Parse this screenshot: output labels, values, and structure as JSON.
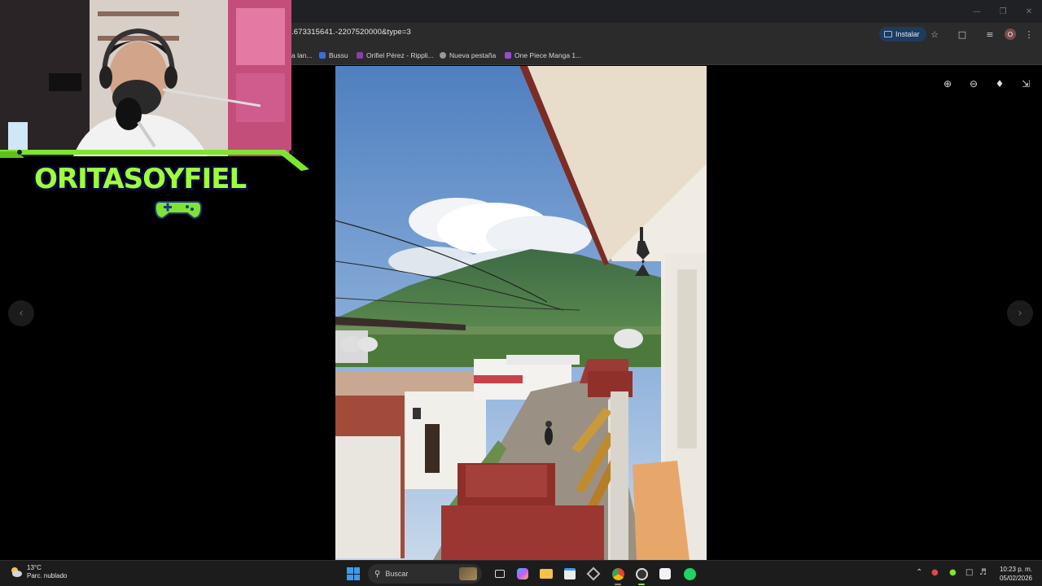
{
  "browser": {
    "url": ".673315641.-2207520000&type=3",
    "install_label": "Instalar",
    "profile_initial": "O",
    "bookmarks": [
      {
        "label": "a lan...",
        "color": "#555555"
      },
      {
        "label": "Bussu",
        "color": "#3b6fd6"
      },
      {
        "label": "Orifiel Pérez - Rippli...",
        "color": "#8b3fa8"
      },
      {
        "label": "Nueva pestaña",
        "color": "#999999"
      },
      {
        "label": "One Piece Manga 1...",
        "color": "#9a4bd0"
      }
    ]
  },
  "viewer": {
    "zoom_in_icon": "zoom-in-icon",
    "zoom_out_icon": "zoom-out-icon",
    "tag_icon": "tag-icon",
    "exit_fullscreen_icon": "exit-fullscreen-icon",
    "prev_icon": "chevron-left-icon",
    "next_icon": "chevron-right-icon"
  },
  "overlay": {
    "channel_name": "ORITASOYFIEL",
    "accent_color": "#7ee52f"
  },
  "taskbar": {
    "weather_temp": "13°C",
    "weather_desc": "Parc. nublado",
    "search_placeholder": "Buscar",
    "time": "10:23 p. m.",
    "date": "05/02/2026"
  }
}
